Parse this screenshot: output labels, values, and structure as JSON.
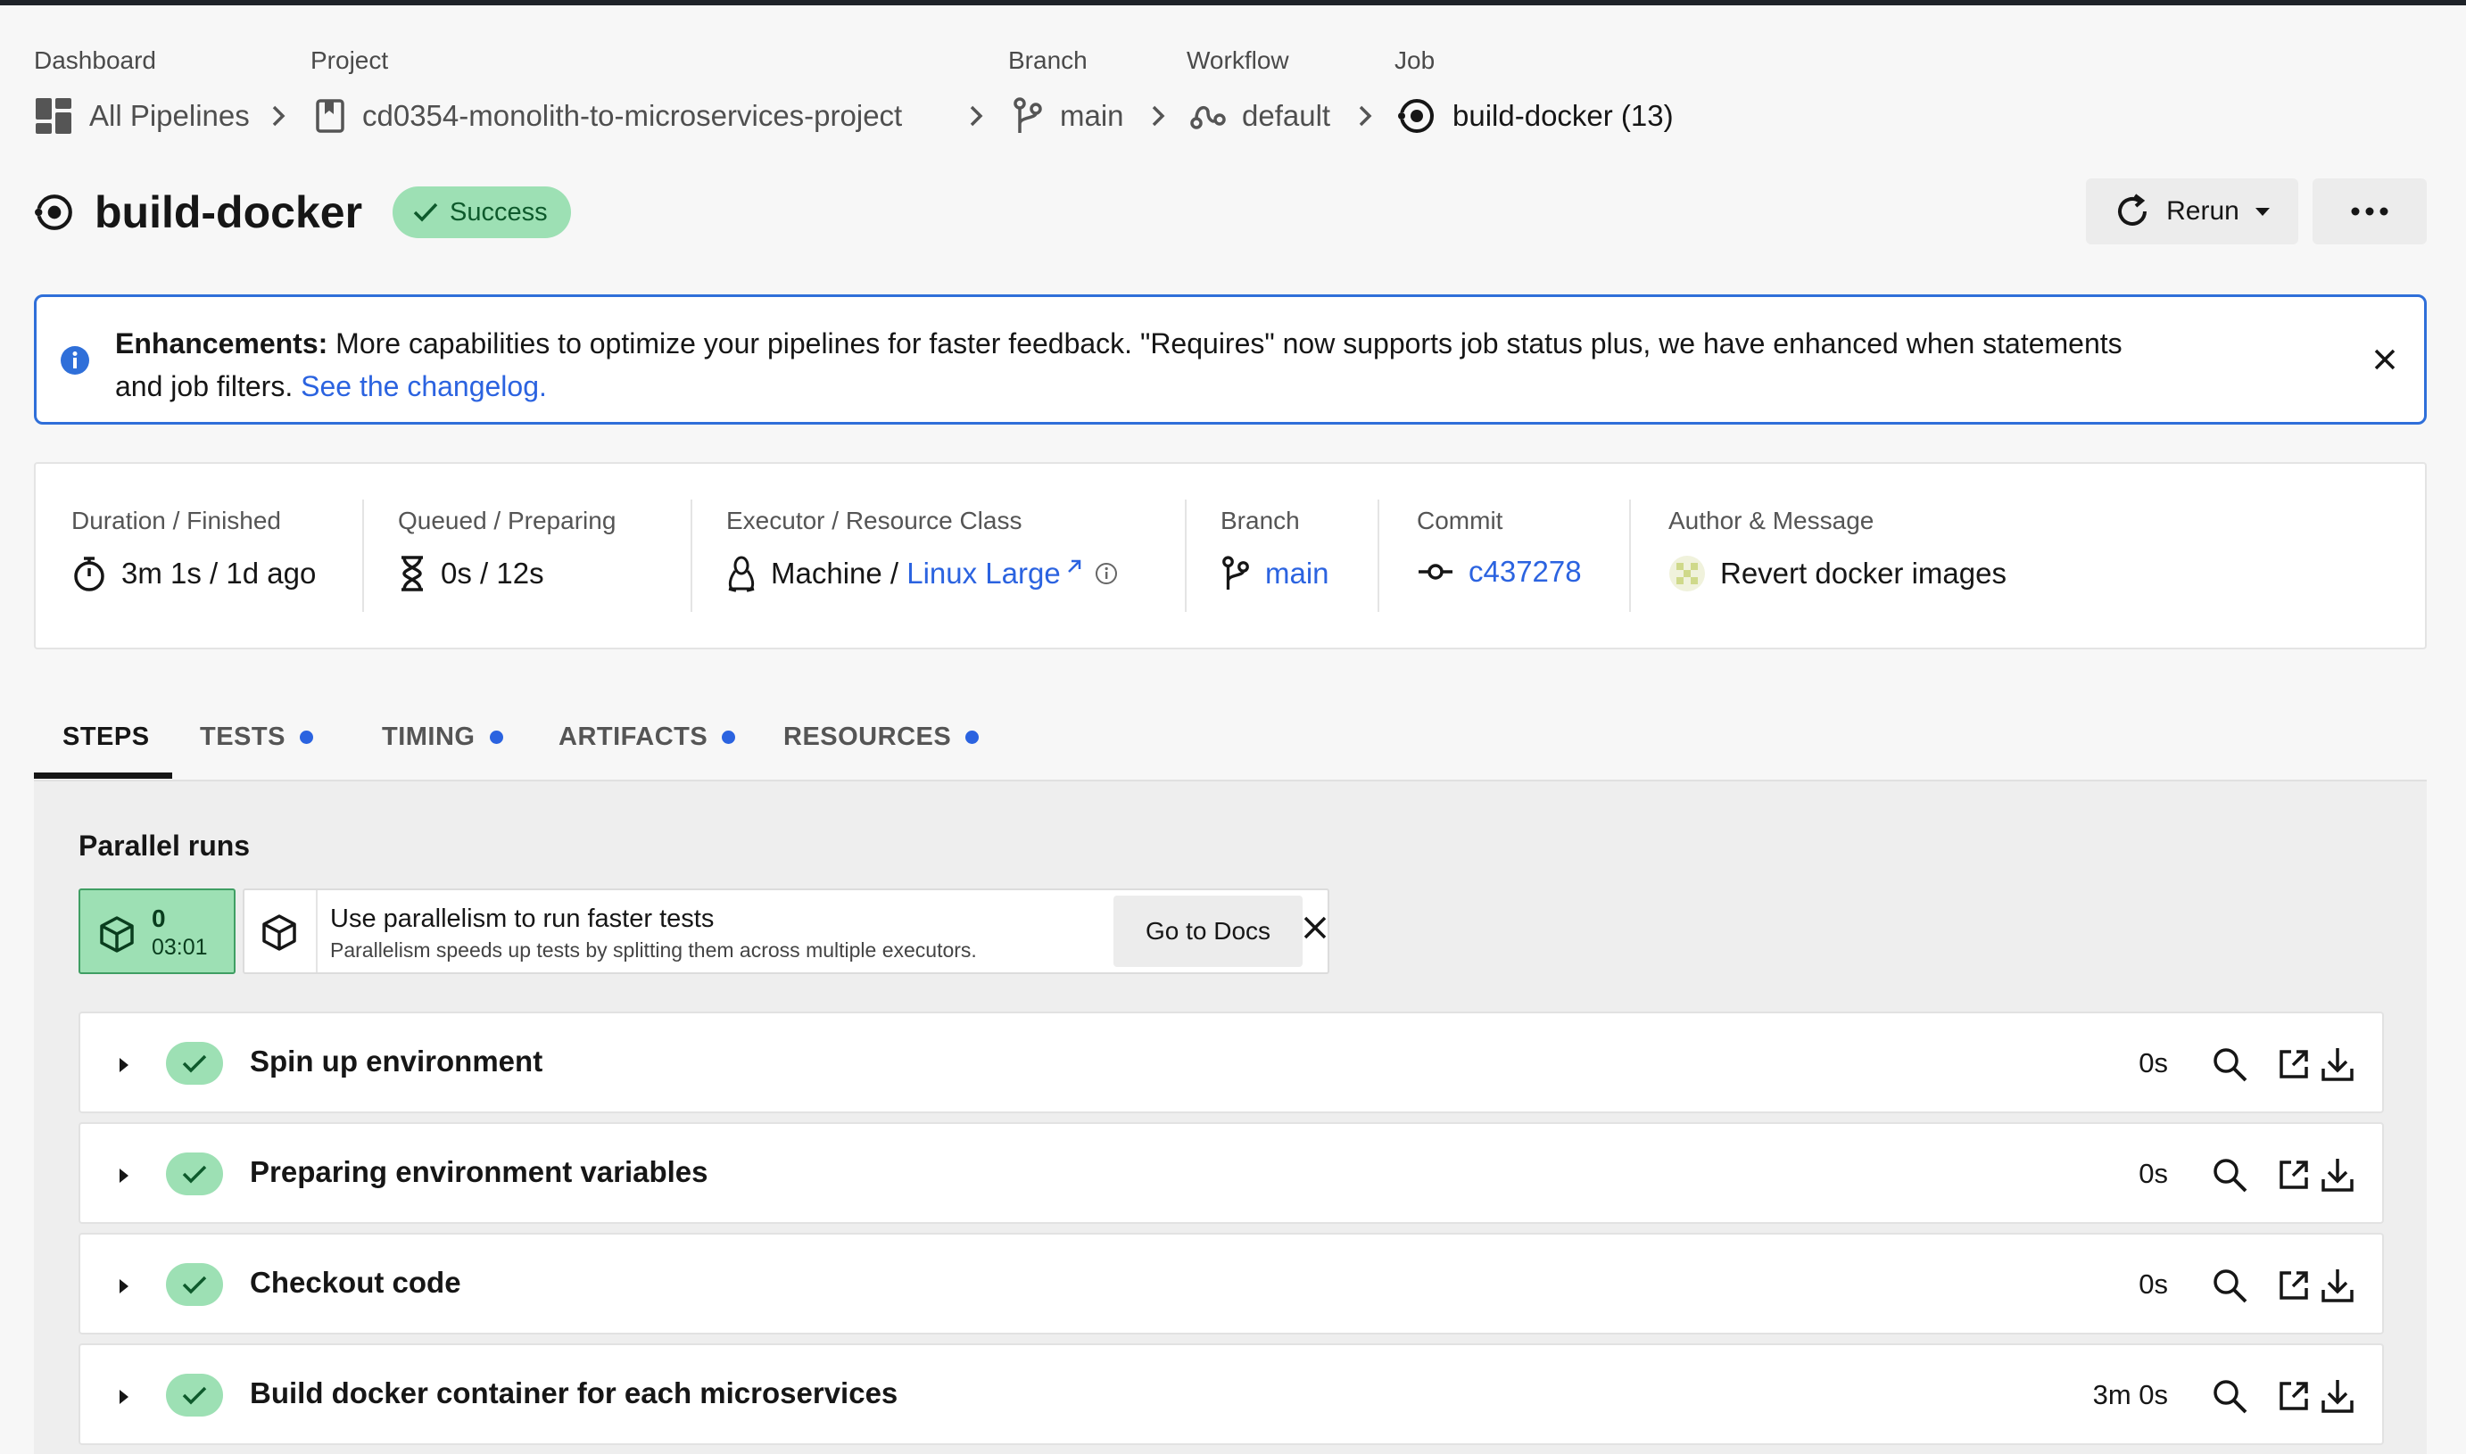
{
  "breadcrumb": {
    "labels": {
      "dashboard": "Dashboard",
      "project": "Project",
      "branch": "Branch",
      "workflow": "Workflow",
      "job": "Job"
    },
    "items": {
      "dashboard": "All Pipelines",
      "project": "cd0354-monolith-to-microservices-project",
      "branch": "main",
      "workflow": "default",
      "job": "build-docker (13)"
    }
  },
  "job": {
    "title": "build-docker",
    "status": "Success",
    "status_color": "#9de0b4",
    "rerun_label": "Rerun"
  },
  "banner": {
    "bold": "Enhancements:",
    "text_line1": " More capabilities to optimize your pipelines for faster feedback. \"Requires\" now supports job status plus, we have enhanced when statements",
    "text_line2": "and job filters. ",
    "link": "See the changelog.",
    "border_color": "#2f6fd9"
  },
  "info": {
    "duration": {
      "label": "Duration / Finished",
      "value": "3m 1s / 1d ago"
    },
    "queued": {
      "label": "Queued / Preparing",
      "value": "0s / 12s"
    },
    "executor": {
      "label": "Executor / Resource Class",
      "value": "Machine / ",
      "link": "Linux Large"
    },
    "branch": {
      "label": "Branch",
      "value": "main"
    },
    "commit": {
      "label": "Commit",
      "value": "c437278"
    },
    "author": {
      "label": "Author & Message",
      "value": "Revert docker images"
    }
  },
  "tabs": [
    {
      "label": "STEPS",
      "dot": false
    },
    {
      "label": "TESTS",
      "dot": true
    },
    {
      "label": "TIMING",
      "dot": true
    },
    {
      "label": "ARTIFACTS",
      "dot": true
    },
    {
      "label": "RESOURCES",
      "dot": true
    }
  ],
  "parallel": {
    "heading": "Parallel runs",
    "run_index": "0",
    "run_time": "03:01",
    "tip_title": "Use parallelism to run faster tests",
    "tip_desc": "Parallelism speeds up tests by splitting them across multiple executors.",
    "docs_label": "Go to Docs"
  },
  "steps": [
    {
      "name": "Spin up environment",
      "duration": "0s"
    },
    {
      "name": "Preparing environment variables",
      "duration": "0s"
    },
    {
      "name": "Checkout code",
      "duration": "0s"
    },
    {
      "name": "Build docker container for each microservices",
      "duration": "3m 0s"
    }
  ],
  "colors": {
    "accent_link": "#2b63e0",
    "success_bg": "#9de0b4"
  }
}
